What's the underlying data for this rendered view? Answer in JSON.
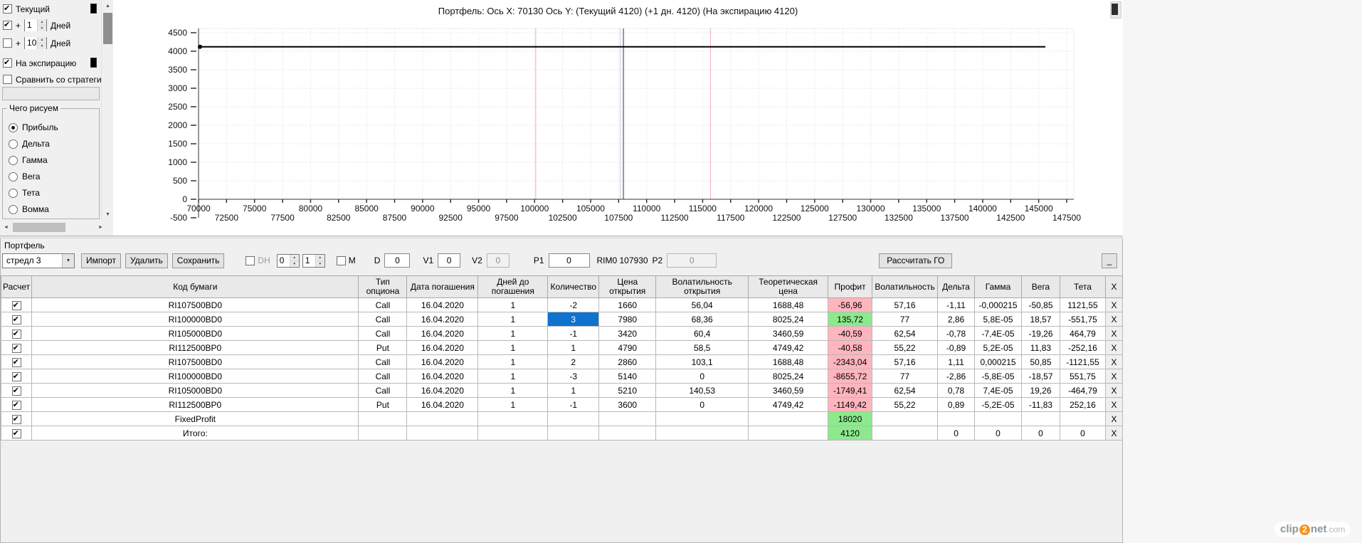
{
  "left_panel": {
    "current": {
      "label": "Текущий",
      "checked": true,
      "swatch_color": "#000000"
    },
    "plus1": {
      "label": "+",
      "value": "1",
      "suffix": "Дней",
      "checked": true
    },
    "plus10": {
      "label": "+",
      "value": "10",
      "suffix": "Дней",
      "checked": false
    },
    "expiration": {
      "label": "На экспирацию",
      "checked": true,
      "swatch_color": "#000000"
    },
    "compare": {
      "label": "Сравнить со стратеги",
      "checked": false
    },
    "draw_group": {
      "title": "Чего рисуем",
      "options": [
        {
          "label": "Прибыль",
          "selected": true
        },
        {
          "label": "Дельта",
          "selected": false
        },
        {
          "label": "Гамма",
          "selected": false
        },
        {
          "label": "Вега",
          "selected": false
        },
        {
          "label": "Тета",
          "selected": false
        },
        {
          "label": "Вомма",
          "selected": false
        }
      ]
    }
  },
  "chart_data": {
    "type": "line",
    "title": "Портфель: Ось X: 70130 Ось Y:  (Текущий 4120)  (+1 дн. 4120)  (На экспирацию 4120)",
    "xlabel": "",
    "ylabel": "",
    "xlim": [
      70000,
      148135
    ],
    "ylim": [
      -500,
      4615
    ],
    "grid": true,
    "x_ticks": [
      70000,
      72500,
      75000,
      77500,
      80000,
      82500,
      85000,
      87500,
      90000,
      92500,
      95000,
      97500,
      100000,
      102500,
      105000,
      107500,
      110000,
      112500,
      115000,
      117500,
      120000,
      122500,
      125000,
      127500,
      130000,
      132500,
      135000,
      137500,
      140000,
      142500,
      145000,
      147500
    ],
    "y_ticks": [
      -500,
      0,
      500,
      1000,
      1500,
      2000,
      2500,
      3000,
      3500,
      4000,
      4500
    ],
    "series": [
      {
        "name": "Прибыль (Текущий / +1 дн. / На экспирацию)",
        "color": "#000000",
        "x": [
          70130,
          145600
        ],
        "y": [
          4120,
          4120
        ]
      }
    ],
    "vlines": [
      {
        "x": 100100,
        "color": "#f4a8cc",
        "width": 1
      },
      {
        "x": 107650,
        "color": "#c8cdd8",
        "width": 1
      },
      {
        "x": 107930,
        "color": "#8b94a8",
        "width": 2
      },
      {
        "x": 115700,
        "color": "#f4a8cc",
        "width": 1
      }
    ]
  },
  "toolbar": {
    "strategy": "стредл 3",
    "import": "Импорт",
    "delete": "Удалить",
    "save": "Сохранить",
    "dh": "DH",
    "dh_checked": false,
    "spin_a": "0",
    "spin_b": "1",
    "m": "M",
    "m_checked": false,
    "d_label": "D",
    "d": "0",
    "v1_label": "V1",
    "v1": "0",
    "v2_label": "V2",
    "v2": "0",
    "p1_label": "P1",
    "p1": "0",
    "rim": "RIM0 107930",
    "p2_label": "P2",
    "p2": "0",
    "calc": "Рассчитать ГО",
    "collapse": "_"
  },
  "portfolio": {
    "label": "Портфель",
    "table": {
      "headers": [
        "Расчет",
        "Код бумаги",
        "Тип опциона",
        "Дата погашения",
        "Дней до погашения",
        "Количество",
        "Цена открытия",
        "Волатильность открытия",
        "Теоретическая цена",
        "Профит",
        "Волатильность",
        "Дельта",
        "Гамма",
        "Вега",
        "Тета",
        "X"
      ],
      "delete_label": "X",
      "rows": [
        {
          "checked": true,
          "code": "RI107500BD0",
          "type": "Call",
          "date": "16.04.2020",
          "days": "1",
          "qty": "-2",
          "price": "1660",
          "vol_open": "56,04",
          "theor": "1688,48",
          "profit": "-56,96",
          "profit_color": "red",
          "vol": "57,16",
          "delta": "-1,11",
          "gamma": "-0,000215",
          "vega": "-50,85",
          "theta": "1121,55"
        },
        {
          "checked": true,
          "code": "RI100000BD0",
          "type": "Call",
          "date": "16.04.2020",
          "days": "1",
          "qty": "3",
          "qty_selected": true,
          "price": "7980",
          "vol_open": "68,36",
          "theor": "8025,24",
          "profit": "135,72",
          "profit_color": "green",
          "vol": "77",
          "delta": "2,86",
          "gamma": "5,8E-05",
          "vega": "18,57",
          "theta": "-551,75"
        },
        {
          "checked": true,
          "code": "RI105000BD0",
          "type": "Call",
          "date": "16.04.2020",
          "days": "1",
          "qty": "-1",
          "price": "3420",
          "vol_open": "60,4",
          "theor": "3460,59",
          "profit": "-40,59",
          "profit_color": "red",
          "vol": "62,54",
          "delta": "-0,78",
          "gamma": "-7,4E-05",
          "vega": "-19,26",
          "theta": "464,79"
        },
        {
          "checked": true,
          "code": "RI112500BP0",
          "type": "Put",
          "date": "16.04.2020",
          "days": "1",
          "qty": "1",
          "price": "4790",
          "vol_open": "58,5",
          "theor": "4749,42",
          "profit": "-40,58",
          "profit_color": "red",
          "vol": "55,22",
          "delta": "-0,89",
          "gamma": "5,2E-05",
          "vega": "11,83",
          "theta": "-252,16"
        },
        {
          "checked": true,
          "code": "RI107500BD0",
          "type": "Call",
          "date": "16.04.2020",
          "days": "1",
          "qty": "2",
          "price": "2860",
          "vol_open": "103,1",
          "theor": "1688,48",
          "profit": "-2343,04",
          "profit_color": "red",
          "vol": "57,16",
          "delta": "1,11",
          "gamma": "0,000215",
          "vega": "50,85",
          "theta": "-1121,55"
        },
        {
          "checked": true,
          "code": "RI100000BD0",
          "type": "Call",
          "date": "16.04.2020",
          "days": "1",
          "qty": "-3",
          "price": "5140",
          "vol_open": "0",
          "theor": "8025,24",
          "profit": "-8655,72",
          "profit_color": "red",
          "vol": "77",
          "delta": "-2,86",
          "gamma": "-5,8E-05",
          "vega": "-18,57",
          "theta": "551,75"
        },
        {
          "checked": true,
          "code": "RI105000BD0",
          "type": "Call",
          "date": "16.04.2020",
          "days": "1",
          "qty": "1",
          "price": "5210",
          "vol_open": "140,53",
          "theor": "3460,59",
          "profit": "-1749,41",
          "profit_color": "red",
          "vol": "62,54",
          "delta": "0,78",
          "gamma": "7,4E-05",
          "vega": "19,26",
          "theta": "-464,79"
        },
        {
          "checked": true,
          "code": "RI112500BP0",
          "type": "Put",
          "date": "16.04.2020",
          "days": "1",
          "qty": "-1",
          "price": "3600",
          "vol_open": "0",
          "theor": "4749,42",
          "profit": "-1149,42",
          "profit_color": "red",
          "vol": "55,22",
          "delta": "0,89",
          "gamma": "-5,2E-05",
          "vega": "-11,83",
          "theta": "252,16"
        },
        {
          "checked": true,
          "code": "FixedProfit",
          "type": "",
          "date": "",
          "days": "",
          "qty": "",
          "price": "",
          "vol_open": "",
          "theor": "",
          "profit": "18020",
          "profit_color": "green",
          "vol": "",
          "delta": "",
          "gamma": "",
          "vega": "",
          "theta": ""
        },
        {
          "checked": true,
          "code": "Итого:",
          "type": "",
          "date": "",
          "days": "",
          "qty": "",
          "price": "",
          "vol_open": "",
          "theor": "",
          "profit": "4120",
          "profit_color": "green",
          "vol": "",
          "delta": "0",
          "gamma": "0",
          "vega": "0",
          "theta": "0"
        }
      ]
    }
  },
  "watermark": {
    "p1": "clip",
    "p2": "2",
    "p3": "net",
    "p4": ".com"
  }
}
